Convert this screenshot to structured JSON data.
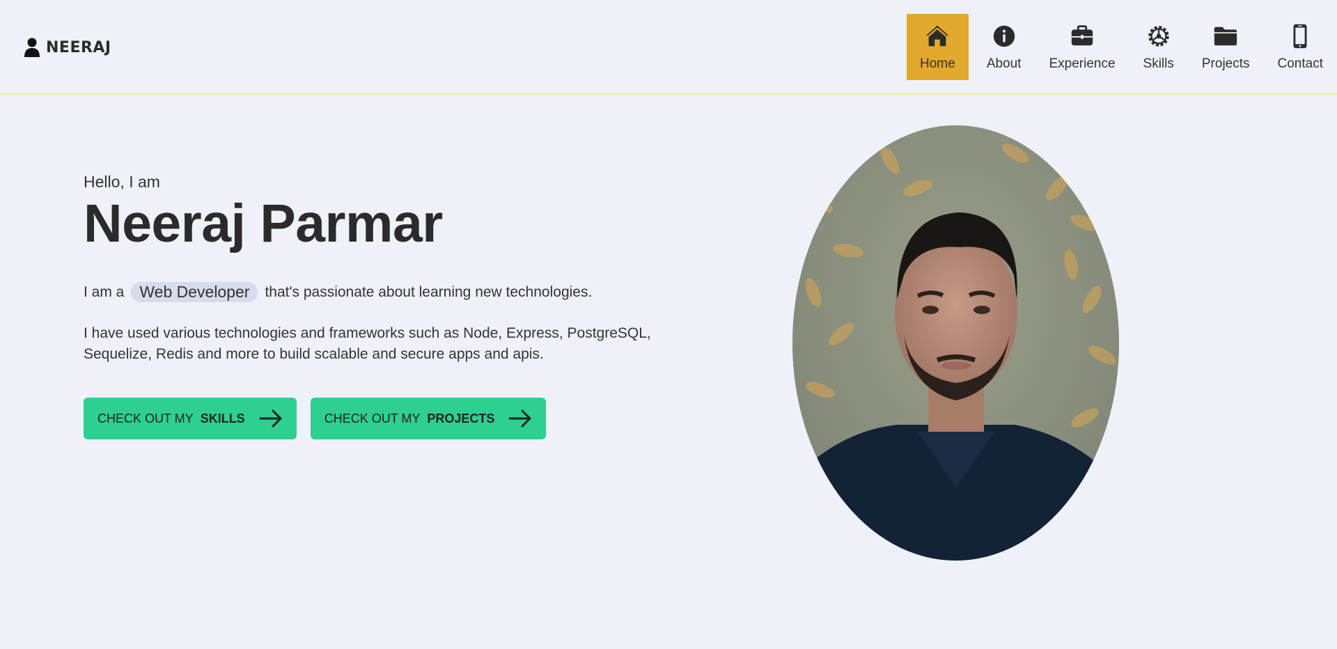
{
  "header": {
    "brand": "NEERAJ",
    "nav": [
      {
        "label": "Home",
        "icon": "home-icon",
        "active": true
      },
      {
        "label": "About",
        "icon": "info-icon"
      },
      {
        "label": "Experience",
        "icon": "briefcase-icon"
      },
      {
        "label": "Skills",
        "icon": "gear-icon"
      },
      {
        "label": "Projects",
        "icon": "folder-icon"
      },
      {
        "label": "Contact",
        "icon": "phone-icon"
      }
    ]
  },
  "hero": {
    "greeting": "Hello, I am",
    "name": "Neeraj Parmar",
    "tagline_prefix": "I am a",
    "role": "Web Developer",
    "tagline_suffix": "that's passionate about learning new technologies.",
    "description": "I have used various technologies and frameworks such as Node, Express, PostgreSQL, Sequelize, Redis and more to build scalable and secure apps and apis.",
    "buttons": [
      {
        "prefix": "CHECK OUT MY",
        "strong": "SKILLS",
        "icon": "arrow-right-icon"
      },
      {
        "prefix": "CHECK OUT MY",
        "strong": "PROJECTS",
        "icon": "arrow-right-icon"
      }
    ]
  },
  "colors": {
    "background": "#eef1f8",
    "nav_active": "#e3a92e",
    "button": "#2fcf8f",
    "role_pill": "#d6dcec",
    "text": "#2b2b2b"
  }
}
